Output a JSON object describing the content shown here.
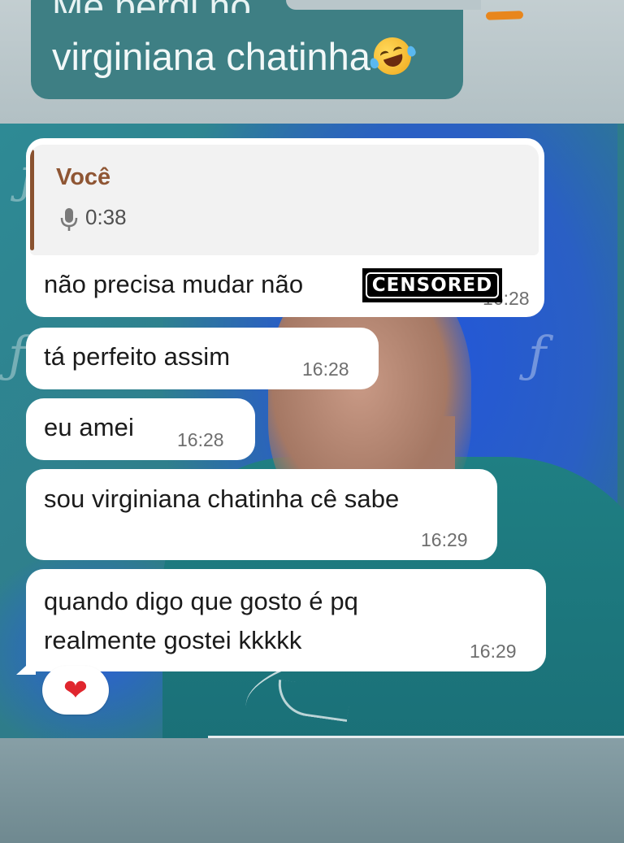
{
  "caption": {
    "line1": "Me perdi no",
    "line2": "virginiana chatinha",
    "emoji": "rolling-on-floor-laughing-icon"
  },
  "quote": {
    "author": "Você",
    "audio_duration": "0:38",
    "icon": "microphone-icon"
  },
  "messages": [
    {
      "text": "não precisa mudar não",
      "time": "16:28",
      "censored_label": "CENSORED"
    },
    {
      "text": "tá perfeito assim",
      "time": "16:28"
    },
    {
      "text": "eu amei",
      "time": "16:28"
    },
    {
      "text": "sou virginiana chatinha cê sabe",
      "time": "16:29"
    },
    {
      "text_line1": "quando digo que gosto é pq",
      "text_line2": "realmente gostei kkkkk",
      "time": "16:29"
    }
  ],
  "reaction": {
    "emoji": "❤",
    "icon": "heart-icon"
  },
  "colors": {
    "caption_bubble": "#3e7f84",
    "bubble": "#ffffff",
    "quote_author": "#8f5634",
    "heart": "#e0262e"
  }
}
